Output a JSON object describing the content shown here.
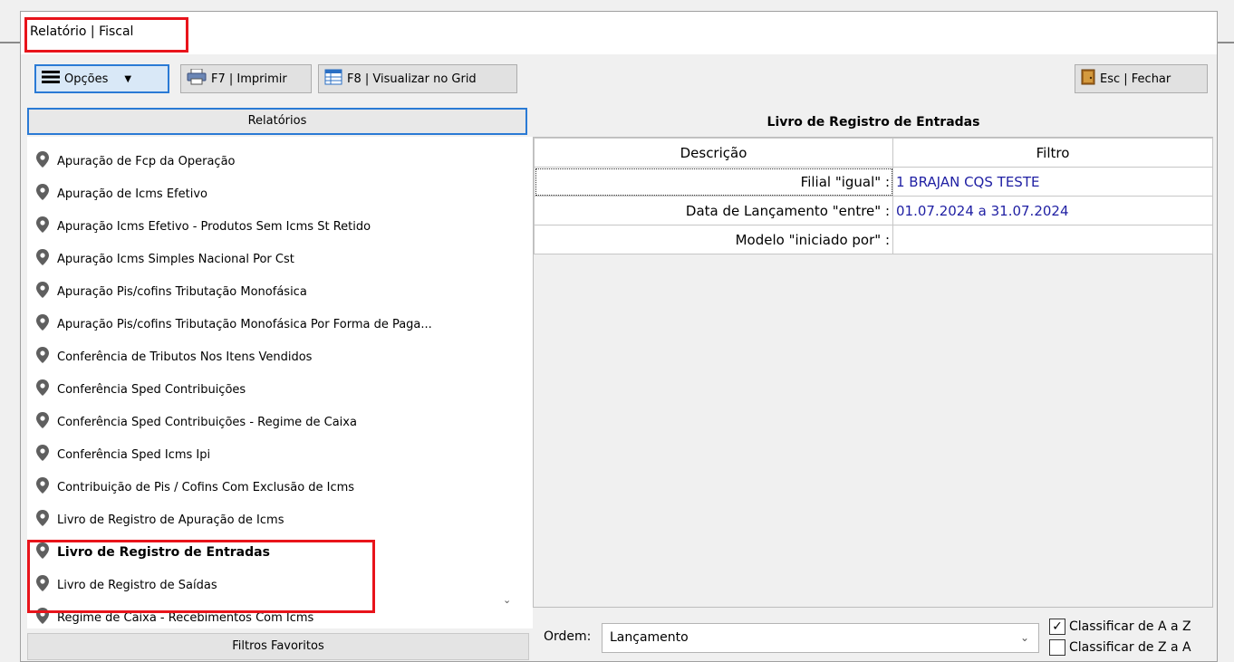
{
  "window": {
    "title": "Relatório | Fiscal"
  },
  "toolbar": {
    "options_label": "Opções",
    "print_label": "F7 | Imprimir",
    "grid_label": "F8 | Visualizar no Grid",
    "close_label": "Esc | Fechar"
  },
  "left_panel": {
    "header": "Relatórios",
    "items": [
      {
        "label": "Apuração de Fcp da Operação"
      },
      {
        "label": "Apuração de Icms Efetivo"
      },
      {
        "label": "Apuração Icms Efetivo - Produtos Sem Icms St Retido"
      },
      {
        "label": "Apuração Icms Simples Nacional Por Cst"
      },
      {
        "label": "Apuração Pis/cofins Tributação Monofásica"
      },
      {
        "label": "Apuração Pis/cofins Tributação Monofásica Por Forma de Paga..."
      },
      {
        "label": "Conferência de Tributos Nos Itens Vendidos"
      },
      {
        "label": "Conferência Sped Contribuições"
      },
      {
        "label": "Conferência Sped Contribuições - Regime de Caixa"
      },
      {
        "label": "Conferência Sped Icms Ipi"
      },
      {
        "label": "Contribuição de Pis / Cofins Com Exclusão de Icms"
      },
      {
        "label": "Livro de Registro de Apuração de Icms"
      },
      {
        "label": "Livro de Registro de Entradas"
      },
      {
        "label": "Livro de Registro de Saídas"
      },
      {
        "label": "Regime de Caixa - Recebimentos Com Icms"
      }
    ],
    "selected_index": 12,
    "footer": "Filtros Favoritos"
  },
  "right_panel": {
    "header": "Livro de Registro de Entradas",
    "columns": [
      "Descrição",
      "Filtro"
    ],
    "rows": [
      {
        "descricao": "Filial \"igual\" :",
        "filtro": "1 BRAJAN CQS TESTE"
      },
      {
        "descricao": "Data de Lançamento \"entre\" :",
        "filtro": "01.07.2024 a 31.07.2024"
      },
      {
        "descricao": "Modelo \"iniciado por\" :",
        "filtro": ""
      }
    ],
    "ordem_label": "Ordem:",
    "ordem_value": "Lançamento",
    "sort_az_label": "Classificar de A a Z",
    "sort_az_checked": true,
    "sort_za_label": "Classificar de Z a A",
    "sort_za_checked": false
  },
  "colors": {
    "accent": "#2a7ad5",
    "highlight": "#e8141b",
    "filter_value": "#1f1fa3"
  }
}
